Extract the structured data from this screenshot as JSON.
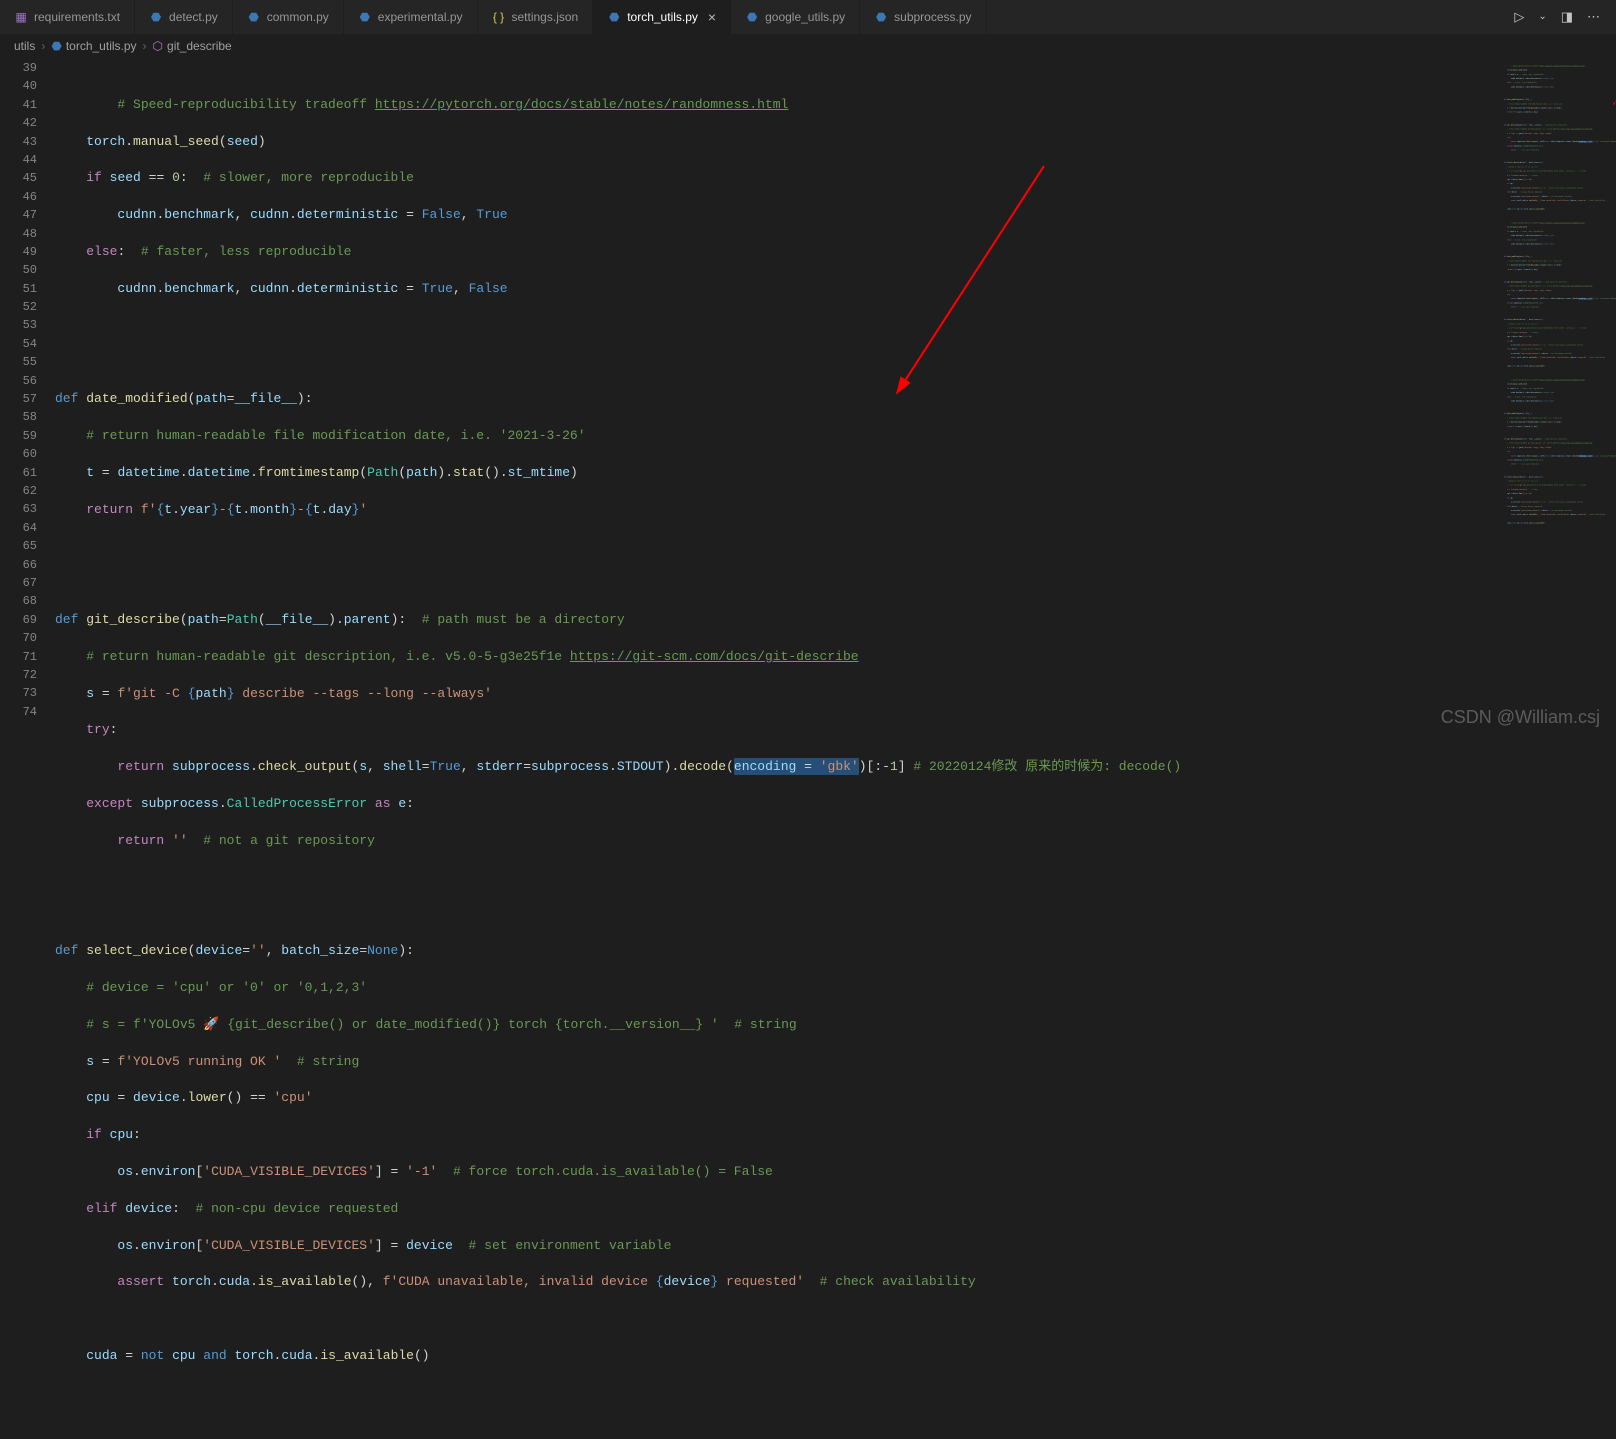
{
  "tabs": [
    {
      "label": "requirements.txt",
      "icon": "txt"
    },
    {
      "label": "detect.py",
      "icon": "py"
    },
    {
      "label": "common.py",
      "icon": "py"
    },
    {
      "label": "experimental.py",
      "icon": "py"
    },
    {
      "label": "settings.json",
      "icon": "json"
    },
    {
      "label": "torch_utils.py",
      "icon": "py",
      "active": true
    },
    {
      "label": "google_utils.py",
      "icon": "py"
    },
    {
      "label": "subprocess.py",
      "icon": "py"
    }
  ],
  "breadcrumbs": {
    "b1": "utils",
    "b2": "torch_utils.py",
    "b3": "git_describe"
  },
  "lines": {
    "start": 39,
    "end": 74
  },
  "watermark": "CSDN @William.csj"
}
